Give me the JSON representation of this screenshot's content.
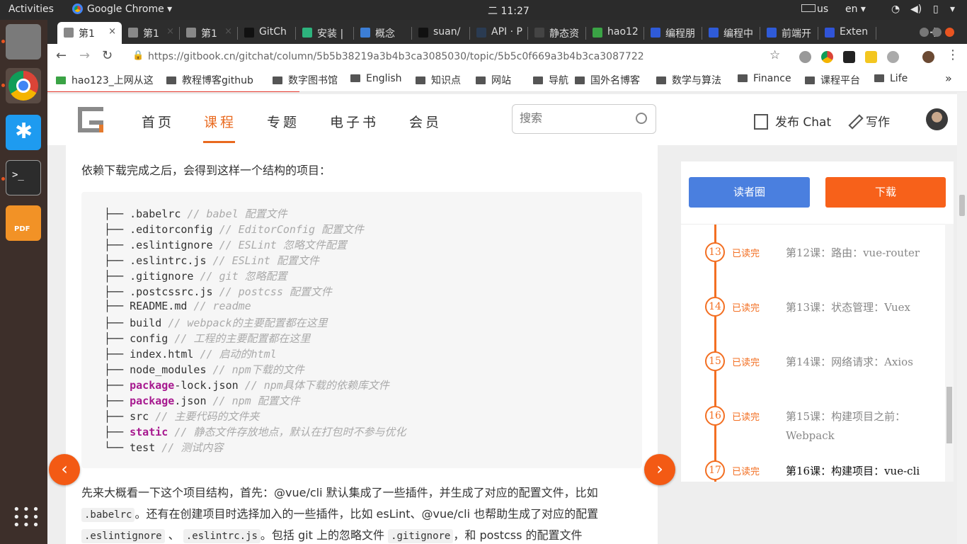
{
  "topbar": {
    "activities": "Activities",
    "app_name": "Google Chrome ▾",
    "clock": "二 11:27",
    "keyboard": "us",
    "lang": "en ▾"
  },
  "tabs": [
    {
      "label": "第1",
      "icon_color": "#888888"
    },
    {
      "label": "第1",
      "icon_color": "#888888"
    },
    {
      "label": "第1",
      "icon_color": "#888888"
    },
    {
      "label": "GitCh",
      "icon_color": "#111111"
    },
    {
      "label": "安装 |",
      "icon_color": "#2db37d"
    },
    {
      "label": "概念",
      "icon_color": "#3c7ed6"
    },
    {
      "label": "suan/",
      "icon_color": "#111111"
    },
    {
      "label": "API · P",
      "icon_color": "#2a3b52"
    },
    {
      "label": "静态资",
      "icon_color": "#444444"
    },
    {
      "label": "hao12",
      "icon_color": "#3aa345"
    },
    {
      "label": "编程朋",
      "icon_color": "#2f5bd8"
    },
    {
      "label": "编程中",
      "icon_color": "#2f5bd8"
    },
    {
      "label": "前端开",
      "icon_color": "#2f5bd8"
    },
    {
      "label": "Exten",
      "icon_color": "#3054d8"
    }
  ],
  "address": {
    "url": "https://gitbook.cn/gitchat/column/5b5b38219a3b4b3ca3085030/topic/5b5c0f669a3b4b3ca3087722"
  },
  "bookmarks": [
    "hao123_上网从这",
    "教程博客github",
    "数字图书馆",
    "English",
    "知识点",
    "网站",
    "导航",
    "国外名博客",
    "数学与算法",
    "Finance",
    "课程平台",
    "Life"
  ],
  "site": {
    "nav": [
      "首页",
      "课程",
      "专题",
      "电子书",
      "会员"
    ],
    "active_nav": "课程",
    "search_placeholder": "搜索",
    "publish_chat": "发布 Chat",
    "write": "写作"
  },
  "article": {
    "intro": "依赖下载完成之后，会得到这样一个结构的项目：",
    "tree": [
      {
        "prefix": "├── ",
        "kw": "",
        "name": ".babelrc",
        "comment": "// babel 配置文件"
      },
      {
        "prefix": "├── ",
        "kw": "",
        "name": ".editorconfig",
        "comment": "// EditorConfig 配置文件"
      },
      {
        "prefix": "├── ",
        "kw": "",
        "name": ".eslintignore",
        "comment": "// ESLint 忽略文件配置"
      },
      {
        "prefix": "├── ",
        "kw": "",
        "name": ".eslintrc.js",
        "comment": "// ESLint 配置文件"
      },
      {
        "prefix": "├── ",
        "kw": "",
        "name": ".gitignore",
        "comment": "// git 忽略配置"
      },
      {
        "prefix": "├── ",
        "kw": "",
        "name": ".postcssrc.js",
        "comment": "// postcss 配置文件"
      },
      {
        "prefix": "├── ",
        "kw": "",
        "name": "README.md",
        "comment": "// readme"
      },
      {
        "prefix": "├── ",
        "kw": "",
        "name": "build",
        "comment": "// webpack的主要配置都在这里"
      },
      {
        "prefix": "├── ",
        "kw": "",
        "name": "config",
        "comment": "// 工程的主要配置都在这里"
      },
      {
        "prefix": "├── ",
        "kw": "",
        "name": "index.html",
        "comment": "// 启动的html"
      },
      {
        "prefix": "├── ",
        "kw": "",
        "name": "node_modules",
        "comment": "// npm下载的文件"
      },
      {
        "prefix": "├── ",
        "kw": "package",
        "name": "-lock.json",
        "comment": "// npm具体下载的依赖库文件"
      },
      {
        "prefix": "├── ",
        "kw": "package",
        "name": ".json",
        "comment": "// npm 配置文件"
      },
      {
        "prefix": "├── ",
        "kw": "",
        "name": "src",
        "comment": "// 主要代码的文件夹"
      },
      {
        "prefix": "├── ",
        "kw": "static",
        "name": "",
        "comment": "// 静态文件存放地点，默认在打包时不参与优化"
      },
      {
        "prefix": "└── ",
        "kw": "",
        "name": "test",
        "comment": "// 测试内容"
      }
    ],
    "para1": "先来大概看一下这个项目结构，首先：@vue/cli 默认集成了一些插件，并生成了对应的配置文件，比如",
    "para2_code1": ".babelrc",
    "para2_text": "。还有在创建项目时选择加入的一些插件，比如 esLint、@vue/cli 也帮助生成了对应的配置",
    "para3_code1": ".eslintignore",
    "para3_sep": " 、 ",
    "para3_code2": ".eslintrc.js",
    "para3_text": "。包括 git 上的忽略文件 ",
    "para3_code3": ".gitignore",
    "para3_tail": "，和 postcss 的配置文件",
    "prev_arrow": "‹",
    "next_arrow": "›"
  },
  "sidebar": {
    "readers_label": "读者圈",
    "download_label": "下载",
    "lessons": [
      {
        "num": "13",
        "status": "已读完",
        "title": "第12课：路由：vue-router",
        "current": false
      },
      {
        "num": "14",
        "status": "已读完",
        "title": "第13课：状态管理：Vuex",
        "current": false
      },
      {
        "num": "15",
        "status": "已读完",
        "title": "第14课：网络请求：Axios",
        "current": false
      },
      {
        "num": "16",
        "status": "已读完",
        "title": "第15课：构建项目之前：Webpack",
        "current": false
      },
      {
        "num": "17",
        "status": "已读完",
        "title": "第16课：构建项目：vue-cli",
        "current": true
      }
    ]
  },
  "colors": {
    "accent": "#f36f22",
    "readers_button": "#4a7fdf",
    "download_button": "#f7611a",
    "code_keyword": "#a7198f"
  }
}
